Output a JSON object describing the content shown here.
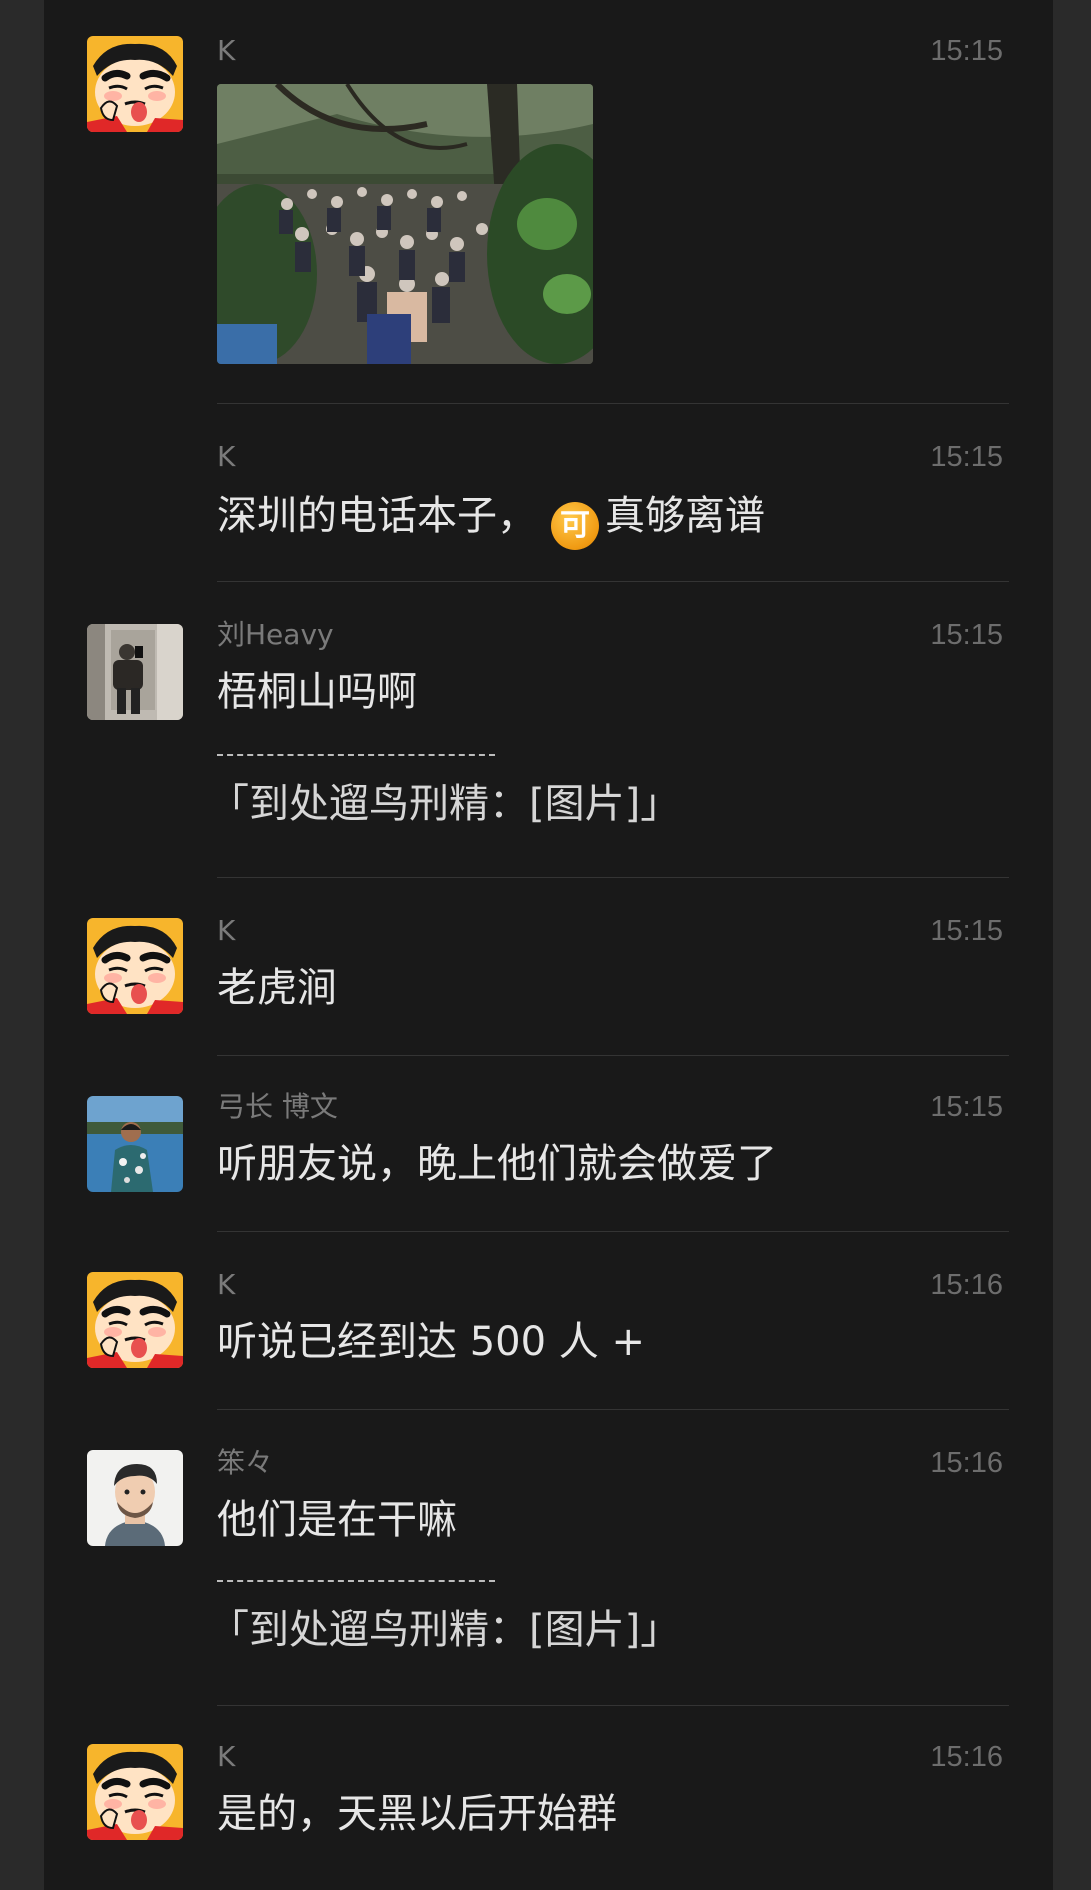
{
  "chat": {
    "messages": [
      {
        "sender": "K",
        "time": "15:15",
        "avatar": "crayon-shin-chan-avatar",
        "image": "photo-crowd-in-forest"
      },
      {
        "sender": "K",
        "time": "15:15",
        "text_before": "深圳的电话本子，",
        "emoji": "可",
        "text_after": "真够离谱"
      },
      {
        "sender": "刘Heavy",
        "time": "15:15",
        "avatar": "man-mirror-selfie-avatar",
        "text": "梧桐山吗啊",
        "quote": "「到处遛鸟刑精：[图片]」"
      },
      {
        "sender": "K",
        "time": "15:15",
        "avatar": "crayon-shin-chan-avatar",
        "text": "老虎涧"
      },
      {
        "sender": "弓长 博文",
        "time": "15:15",
        "avatar": "man-by-sea-avatar",
        "text": "听朋友说，晚上他们就会做爱了"
      },
      {
        "sender": "K",
        "time": "15:16",
        "avatar": "crayon-shin-chan-avatar",
        "text": "听说已经到达 500 人 +"
      },
      {
        "sender": "笨々",
        "time": "15:16",
        "avatar": "cartoon-man-portrait-avatar",
        "text": "他们是在干嘛",
        "quote": "「到处遛鸟刑精：[图片]」"
      },
      {
        "sender": "K",
        "time": "15:16",
        "avatar": "crayon-shin-chan-avatar",
        "text": "是的，天黑以后开始群"
      }
    ]
  },
  "colors": {
    "background": "#191919",
    "outer": "#2a2a2a",
    "text": "#e6e6e6",
    "meta": "#7a7a7a",
    "divider": "#343434",
    "emoji": "#f09a12"
  }
}
